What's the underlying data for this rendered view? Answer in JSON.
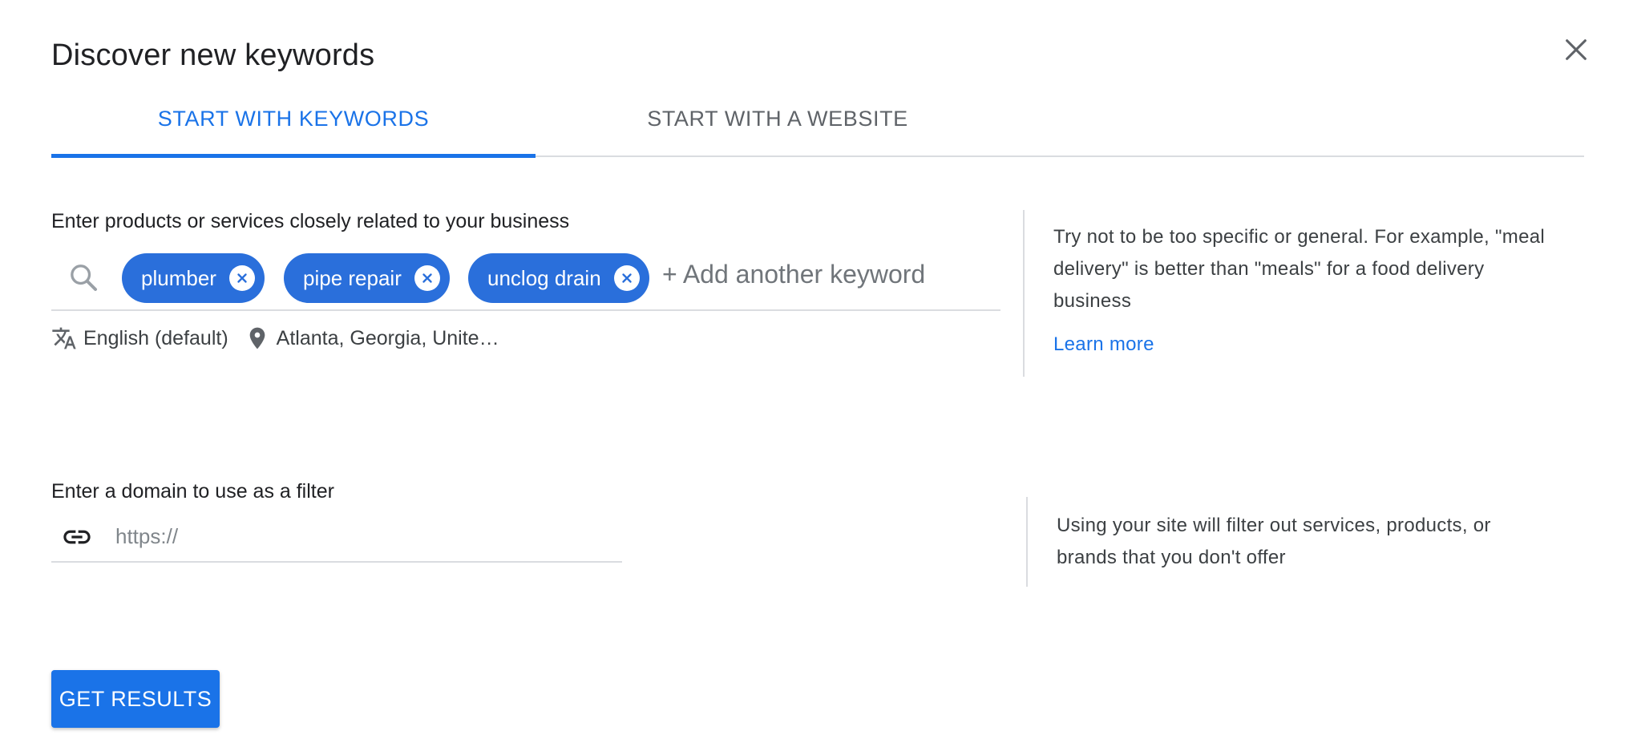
{
  "dialog": {
    "title": "Discover new keywords",
    "close_icon": "close-icon"
  },
  "tabs": [
    {
      "label": "START WITH KEYWORDS",
      "active": true
    },
    {
      "label": "START WITH A WEBSITE",
      "active": false
    }
  ],
  "keywords_section": {
    "label": "Enter products or services closely related to your business",
    "search_icon": "search-icon",
    "chips": [
      {
        "label": "plumber"
      },
      {
        "label": "pipe repair"
      },
      {
        "label": "unclog drain"
      }
    ],
    "add_placeholder": "+ Add another keyword",
    "language": {
      "icon": "translate-icon",
      "label": "English (default)"
    },
    "location": {
      "icon": "location-pin-icon",
      "label": "Atlanta, Georgia, Unite…"
    },
    "help_text": "Try not to be too specific or general. For example, \"meal delivery\" is better than \"meals\" for a food delivery business",
    "learn_more": "Learn more"
  },
  "domain_section": {
    "label": "Enter a domain to use as a filter",
    "link_icon": "link-icon",
    "placeholder": "https://",
    "value": "",
    "help_text": "Using your site will filter out services, products, or brands that you don't offer"
  },
  "actions": {
    "get_results": "GET RESULTS"
  },
  "colors": {
    "accent": "#1a73e8",
    "chip": "#2a6fdb",
    "divider": "#dadce0",
    "text_secondary": "#5f6368"
  }
}
